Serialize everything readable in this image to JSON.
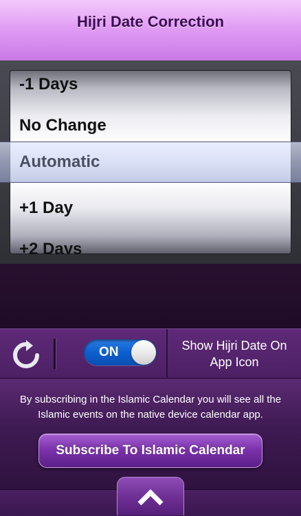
{
  "header": {
    "title": "Hijri Date Correction"
  },
  "picker": {
    "options": [
      "-1 Days",
      "No Change",
      "Automatic",
      "+1 Day",
      "+2 Days"
    ],
    "selected_label": "Automatic"
  },
  "controls": {
    "refresh_icon": "refresh-icon",
    "toggle_label": "ON",
    "toggle_state": "on",
    "toggle_color": "#0d5fcf",
    "show_hijri_label": "Show Hijri Date On App Icon"
  },
  "subscribe": {
    "description": "By subscribing in the Islamic Calendar you will see all the Islamic events on the native device calendar app.",
    "button_label": "Subscribe To Islamic Calendar"
  },
  "bottom_bar": {
    "up_icon": "chevron-up-icon"
  },
  "colors": {
    "header_purple": "#e19ef4",
    "title_dark_purple": "#3b0b52",
    "background_dark_purple": "#2a1238",
    "accent_purple": "#7c33ad"
  }
}
